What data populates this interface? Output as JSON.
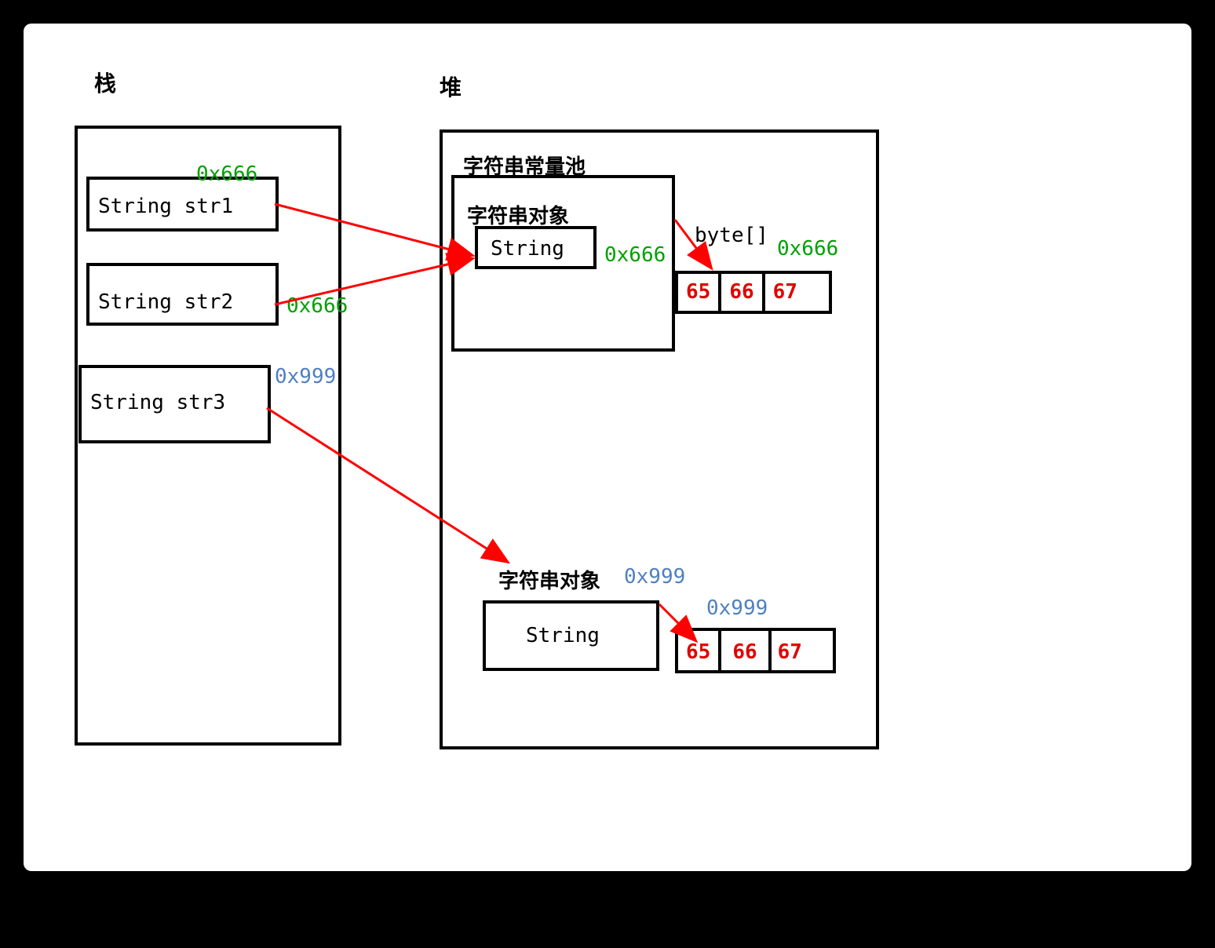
{
  "stack": {
    "title": "栈",
    "vars": [
      {
        "name": "String str1",
        "addr": "0x666",
        "addr_color": "green"
      },
      {
        "name": "String str2",
        "addr": "0x666",
        "addr_color": "green"
      },
      {
        "name": "String str3",
        "addr": "0x999",
        "addr_color": "blue"
      }
    ]
  },
  "heap": {
    "title": "堆",
    "pool": {
      "title": "字符串常量池",
      "object_label": "字符串对象",
      "string_box": "String",
      "addr": "0x666",
      "byte_label": "byte[]",
      "byte_addr": "0x666",
      "bytes": [
        "65",
        "66",
        "67"
      ]
    },
    "object2": {
      "label": "字符串对象",
      "addr": "0x999",
      "string_box": "String",
      "byte_addr": "0x999",
      "bytes": [
        "65",
        "66",
        "67"
      ]
    }
  },
  "colors": {
    "arrow": "#ff0000",
    "green": "#00a000",
    "blue": "#5080c0",
    "red": "#e00000"
  }
}
